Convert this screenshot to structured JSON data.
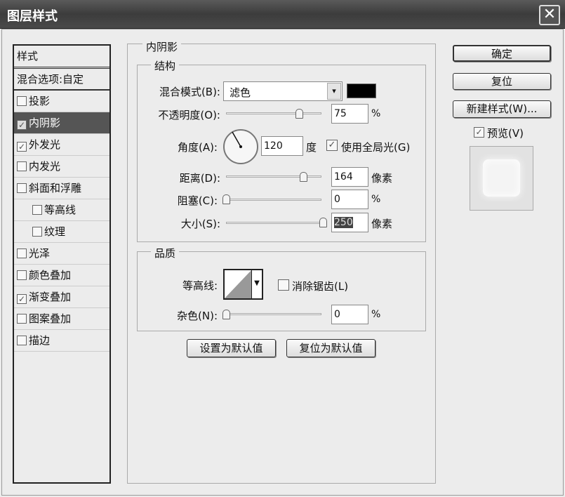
{
  "window": {
    "title": "图层样式",
    "close": "✕"
  },
  "sidebar": {
    "header": "样式",
    "blend_options": "混合选项:自定",
    "items": [
      {
        "label": "投影",
        "checked": false,
        "indent": false
      },
      {
        "label": "内阴影",
        "checked": true,
        "indent": false,
        "selected": true
      },
      {
        "label": "外发光",
        "checked": true,
        "indent": false
      },
      {
        "label": "内发光",
        "checked": false,
        "indent": false
      },
      {
        "label": "斜面和浮雕",
        "checked": false,
        "indent": false
      },
      {
        "label": "等高线",
        "checked": false,
        "indent": true
      },
      {
        "label": "纹理",
        "checked": false,
        "indent": true
      },
      {
        "label": "光泽",
        "checked": false,
        "indent": false
      },
      {
        "label": "颜色叠加",
        "checked": false,
        "indent": false
      },
      {
        "label": "渐变叠加",
        "checked": true,
        "indent": false
      },
      {
        "label": "图案叠加",
        "checked": false,
        "indent": false
      },
      {
        "label": "描边",
        "checked": false,
        "indent": false
      }
    ]
  },
  "panel": {
    "title": "内阴影",
    "structure": {
      "title": "结构",
      "blend_mode_label": "混合模式(B):",
      "blend_mode": "滤色",
      "color": "#000000",
      "opacity_label": "不透明度(O):",
      "opacity": "75",
      "opacity_unit": "%",
      "angle_label": "角度(A):",
      "angle": "120",
      "angle_unit": "度",
      "global_light": "使用全局光(G)",
      "global_light_checked": true,
      "distance_label": "距离(D):",
      "distance": "164",
      "distance_unit": "像素",
      "choke_label": "阻塞(C):",
      "choke": "0",
      "choke_unit": "%",
      "size_label": "大小(S):",
      "size": "250",
      "size_unit": "像素"
    },
    "quality": {
      "title": "品质",
      "contour_label": "等高线:",
      "antialias": "消除锯齿(L)",
      "antialias_checked": false,
      "noise_label": "杂色(N):",
      "noise": "0",
      "noise_unit": "%"
    },
    "make_default": "设置为默认值",
    "reset_default": "复位为默认值"
  },
  "buttons": {
    "ok": "确定",
    "reset": "复位",
    "new_style": "新建样式(W)...",
    "preview": "预览(V)",
    "preview_checked": true
  }
}
